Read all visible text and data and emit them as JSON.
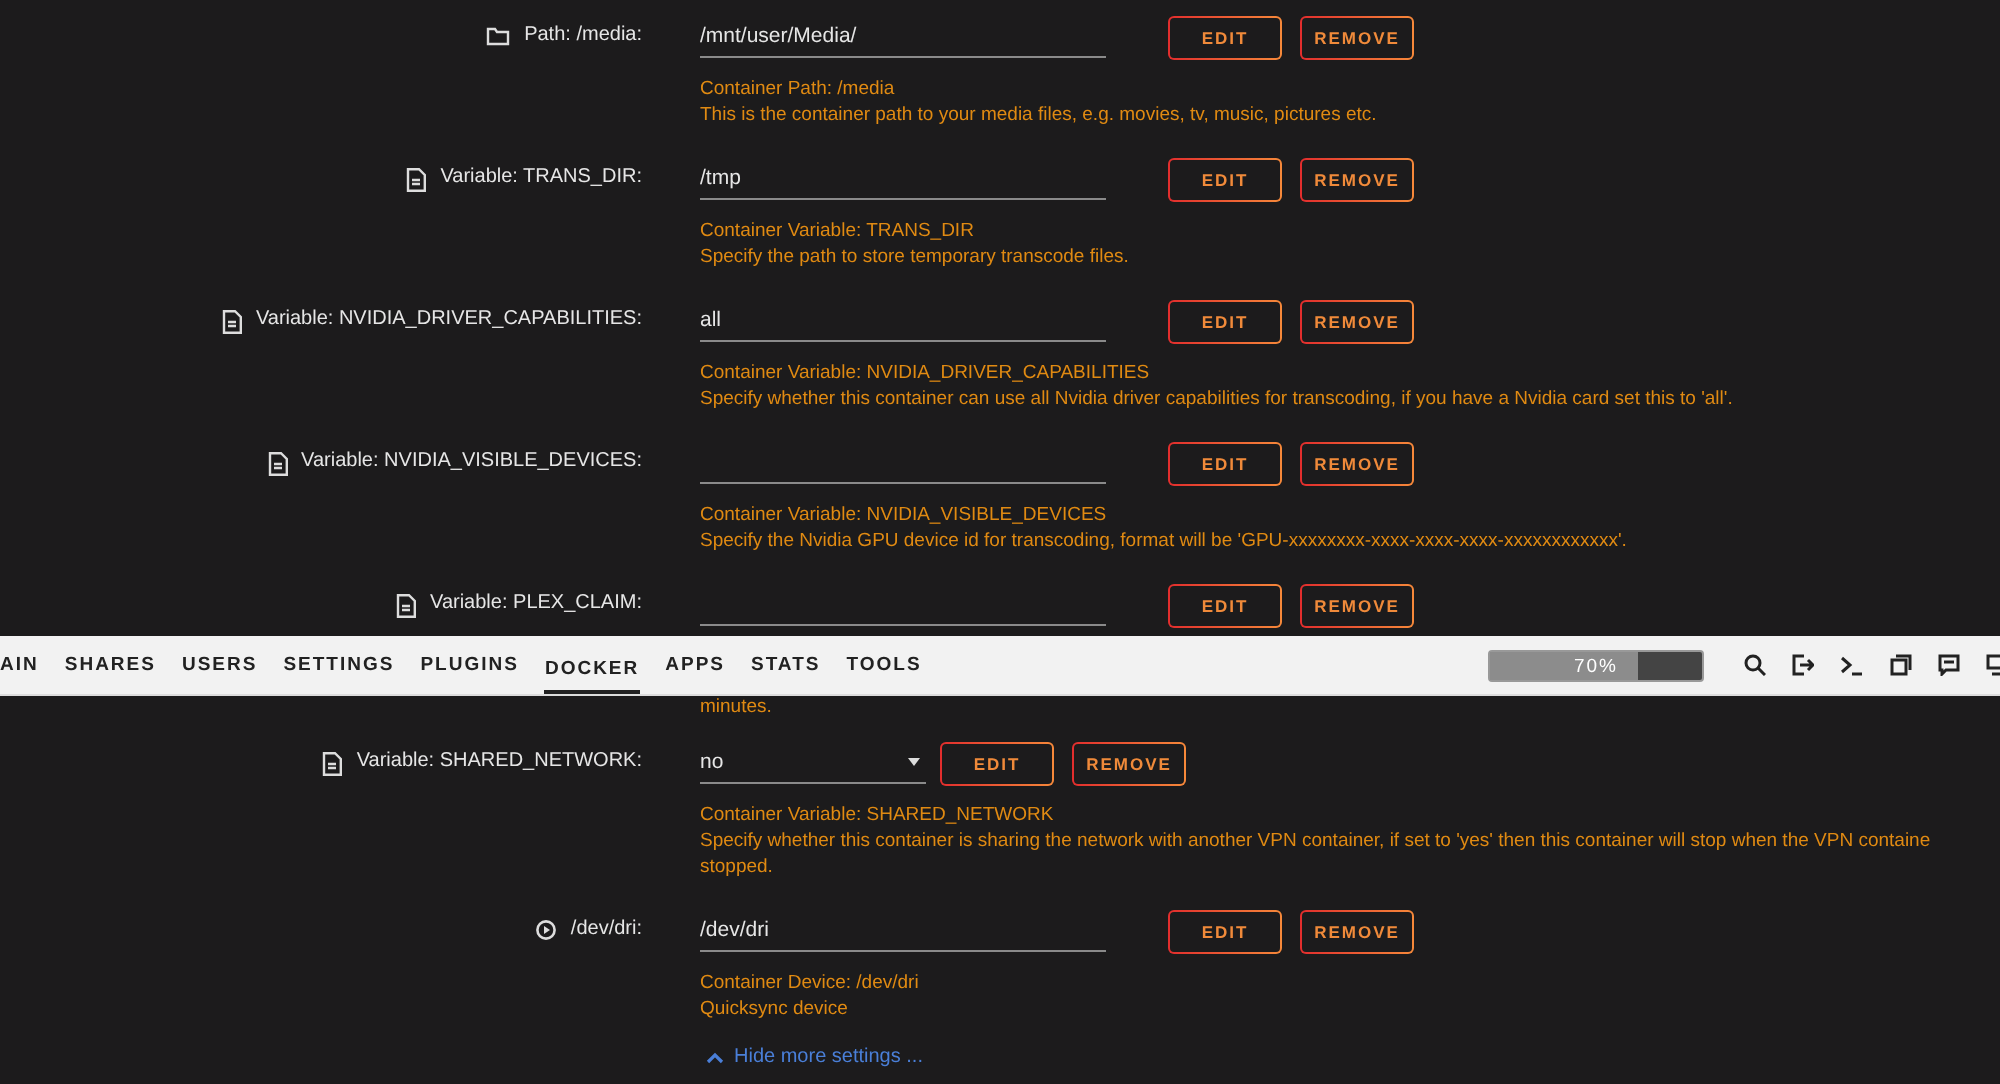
{
  "settings_top": [
    {
      "kind": "path",
      "label": "Path: /media:",
      "field": {
        "kind": "text",
        "value": "/mnt/user/Media/"
      },
      "buttons": [
        "EDIT",
        "REMOVE"
      ],
      "description": [
        "Container Path: /media",
        "This is the container path to your media files, e.g. movies, tv, music, pictures etc."
      ]
    },
    {
      "kind": "variable",
      "label": "Variable: TRANS_DIR:",
      "field": {
        "kind": "text",
        "value": "/tmp"
      },
      "buttons": [
        "EDIT",
        "REMOVE"
      ],
      "description": [
        "Container Variable: TRANS_DIR",
        "Specify the path to store temporary transcode files."
      ]
    },
    {
      "kind": "variable",
      "label": "Variable: NVIDIA_DRIVER_CAPABILITIES:",
      "field": {
        "kind": "text",
        "value": "all"
      },
      "buttons": [
        "EDIT",
        "REMOVE"
      ],
      "description": [
        "Container Variable: NVIDIA_DRIVER_CAPABILITIES",
        "Specify whether this container can use all Nvidia driver capabilities for transcoding, if you have a Nvidia card set this to 'all'."
      ]
    },
    {
      "kind": "variable",
      "label": "Variable: NVIDIA_VISIBLE_DEVICES:",
      "field": {
        "kind": "text"
      },
      "buttons": [
        "EDIT",
        "REMOVE"
      ],
      "description": [
        "Container Variable: NVIDIA_VISIBLE_DEVICES",
        "Specify the Nvidia GPU device id for transcoding, format will be 'GPU-xxxxxxxx-xxxx-xxxx-xxxx-xxxxxxxxxxxx'."
      ]
    },
    {
      "kind": "variable",
      "label": "Variable: PLEX_CLAIM:",
      "field": {
        "kind": "text"
      },
      "buttons": [
        "EDIT",
        "REMOVE"
      ]
    }
  ],
  "nav": {
    "items": [
      {
        "label": "AIN",
        "selected": false
      },
      {
        "label": "SHARES",
        "selected": false
      },
      {
        "label": "USERS",
        "selected": false
      },
      {
        "label": "SETTINGS",
        "selected": false
      },
      {
        "label": "PLUGINS",
        "selected": false
      },
      {
        "label": "DOCKER",
        "selected": true
      },
      {
        "label": "APPS",
        "selected": false
      },
      {
        "label": "STATS",
        "selected": false
      },
      {
        "label": "TOOLS",
        "selected": false
      }
    ],
    "usage": {
      "level": 0.7,
      "reading": "70%"
    }
  },
  "partial_text": "minutes.",
  "settings_bottom": [
    {
      "kind": "variable",
      "label": "Variable: SHARED_NETWORK:",
      "field": {
        "kind": "select",
        "value": "no"
      },
      "buttons": [
        "EDIT",
        "REMOVE"
      ],
      "description": [
        "Container Variable: SHARED_NETWORK",
        "Specify whether this container is sharing the network with another VPN container, if set to 'yes' then this container will stop when the VPN containe",
        "stopped."
      ]
    },
    {
      "kind": "device",
      "label": "/dev/dri:",
      "field": {
        "kind": "text",
        "value": "/dev/dri"
      },
      "buttons": [
        "EDIT",
        "REMOVE"
      ],
      "description": [
        "Container Device: /dev/dri",
        "Quicksync device"
      ]
    }
  ],
  "toggle_link": "Hide more settings ..."
}
